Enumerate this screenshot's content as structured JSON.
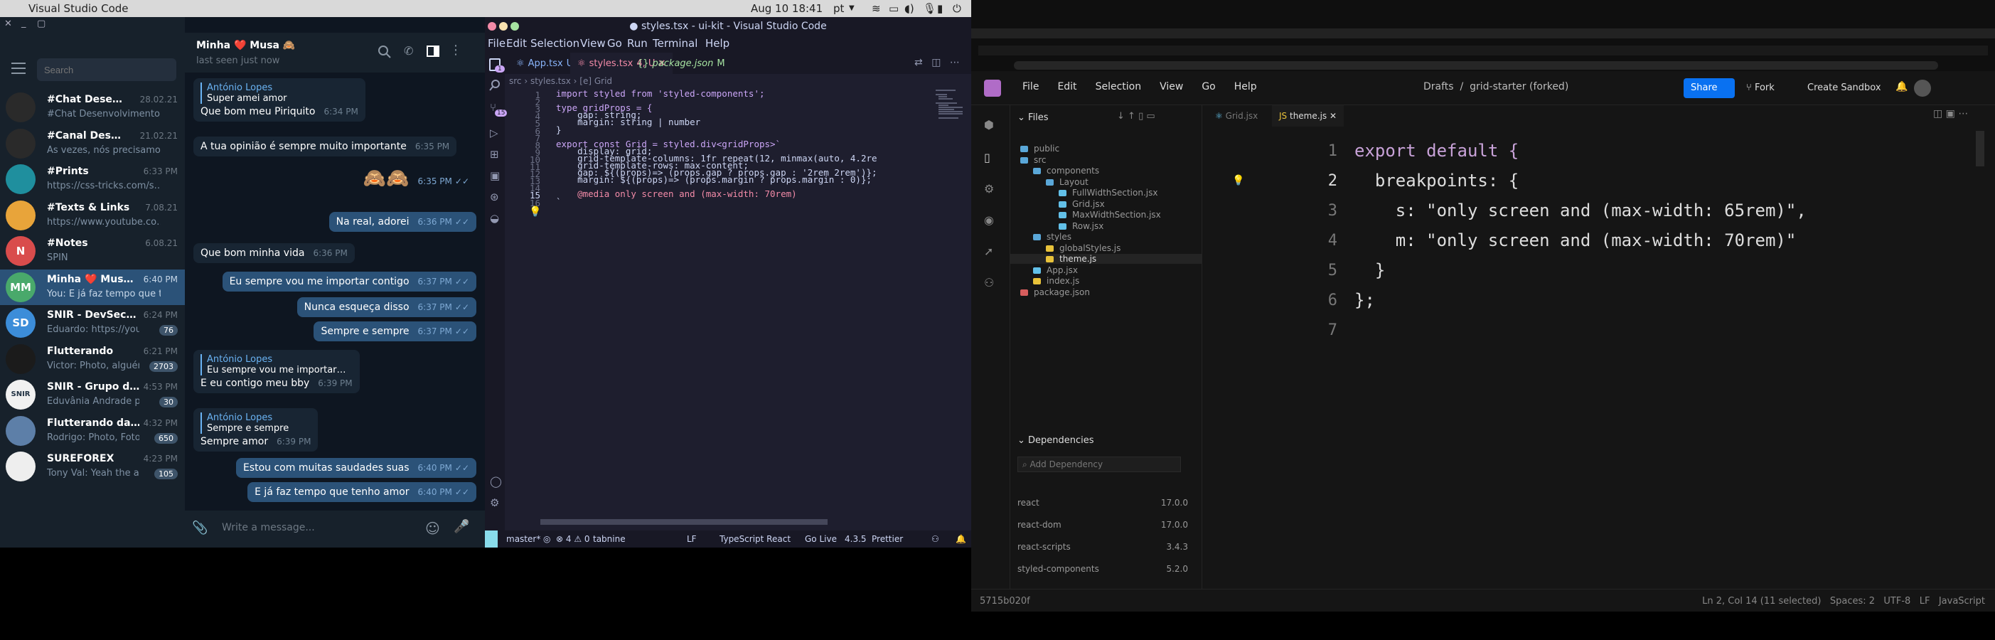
{
  "system": {
    "app_name": "Visual Studio Code",
    "clock": "Aug 10  18:41",
    "language": "pt"
  },
  "telegram": {
    "search_placeholder": "Search",
    "chats": [
      {
        "name": "#Chat Dese…",
        "time": "28.02.21",
        "preview": "#Chat Desenvolvimento…",
        "avatar": "",
        "avatar_color": "#2a2a2a"
      },
      {
        "name": "#Canal Des…",
        "time": "21.02.21",
        "preview": "Às vezes, nós precisamo…",
        "avatar": "",
        "avatar_color": "#2a2a2a"
      },
      {
        "name": "#Prints",
        "time": "6:33 PM",
        "preview": "https://css-tricks.com/s…",
        "avatar": "",
        "avatar_color": "#1f8f9e"
      },
      {
        "name": "#Texts & Links",
        "time": "7.08.21",
        "preview": "https://www.youtube.co…",
        "avatar": "",
        "avatar_color": "#e8a43a"
      },
      {
        "name": "#Notes",
        "time": "6.08.21",
        "preview": "SPIN",
        "avatar": "N",
        "avatar_color": "#d94c4c"
      },
      {
        "name": "Minha ❤️ Mus…",
        "time": "6:40 PM",
        "preview": "You: E já faz tempo que ten…",
        "avatar": "MM",
        "avatar_color": "#49a96b"
      },
      {
        "name": "SNIR - DevSec…",
        "time": "6:24 PM",
        "preview": "Eduardo: https://youtu…",
        "avatar": "SD",
        "avatar_color": "#3c8dd9",
        "badge": "76"
      },
      {
        "name": "Flutterando",
        "time": "6:21 PM",
        "preview": "Victor: Photo, alguém…",
        "avatar": "",
        "avatar_color": "#1b1b1b",
        "badge": "2703"
      },
      {
        "name": "SNIR - Grupo d…",
        "time": "4:53 PM",
        "preview": "Eduvânia Andrade pinn…",
        "avatar": "SNIR",
        "avatar_color": "#f1f1f1",
        "badge": "30"
      },
      {
        "name": "Flutterando da…",
        "time": "4:32 PM",
        "preview": "Rodrigo: Photo, Foto d…",
        "avatar": "",
        "avatar_color": "#5d7fa8",
        "badge": "650"
      },
      {
        "name": "SUREFOREX",
        "time": "4:23 PM",
        "preview": "Tony Val: Yeah the ace…",
        "avatar": "",
        "avatar_color": "#eeeeee",
        "badge": "105"
      }
    ],
    "contact_name": "Minha ❤️ Musa 🙈",
    "contact_status": "last seen just now",
    "messages": [
      {
        "dir": "in",
        "quote_author": "António Lopes",
        "quote_text": "Super amei amor",
        "text": "Que bom meu Piriquito",
        "time": "6:34 PM"
      },
      {
        "dir": "in",
        "text": "A tua opinião é sempre muito importante",
        "time": "6:35 PM"
      },
      {
        "dir": "out",
        "text": "🙈🙈",
        "time": "6:35 PM"
      },
      {
        "dir": "out",
        "text": "Na real, adorei",
        "time": "6:36 PM"
      },
      {
        "dir": "in",
        "text": "Que bom minha vida",
        "time": "6:36 PM"
      },
      {
        "dir": "out",
        "text": "Eu sempre vou me importar contigo",
        "time": "6:37 PM"
      },
      {
        "dir": "out",
        "text": "Nunca esqueça disso",
        "time": "6:37 PM"
      },
      {
        "dir": "out",
        "text": "Sempre e sempre",
        "time": "6:37 PM"
      },
      {
        "dir": "in",
        "quote_author": "António Lopes",
        "quote_text": "Eu sempre vou me importar…",
        "text": "E eu contigo meu bby",
        "time": "6:39 PM"
      },
      {
        "dir": "in",
        "quote_author": "António Lopes",
        "quote_text": "Sempre e sempre",
        "text": "Sempre amor",
        "time": "6:39 PM"
      },
      {
        "dir": "out",
        "text": "Estou com muitas saudades suas",
        "time": "6:40 PM"
      },
      {
        "dir": "out",
        "text": "E já faz tempo que tenho amor",
        "time": "6:40 PM"
      }
    ],
    "composer_placeholder": "Write a message..."
  },
  "vscode": {
    "title": "● styles.tsx - ui-kit - Visual Studio Code",
    "menu": [
      "File",
      "Edit",
      "Selection",
      "View",
      "Go",
      "Run",
      "Terminal",
      "Help"
    ],
    "tabs": [
      {
        "label": "App.tsx",
        "suffix": "U",
        "color": "#89b4fa"
      },
      {
        "label": "styles.tsx",
        "suffix": "4, U",
        "color": "#f38ba8"
      },
      {
        "label": "package.json",
        "suffix": "M",
        "color": "#a6e3a1"
      }
    ],
    "breadcrumb": "src  ›  styles.tsx  ›  [e] Grid",
    "code_lines": [
      "import styled from 'styled-components';",
      "",
      "type gridProps = {",
      "    gap: string;",
      "    margin: string | number",
      "}",
      "",
      "export const Grid = styled.div<gridProps>`",
      "    display: grid;",
      "    grid-template-columns: 1fr repeat(12, minmax(auto, 4.2re",
      "    grid-template-rows: max-content;",
      "    gap: ${(props)=> (props.gap ? props.gap : '2rem 2rem')};",
      "    margin: ${(props)=> (props.margin ? props.margin : 0)};",
      "",
      "    @media only screen and (max-width: 70rem)",
      "`"
    ],
    "status": {
      "branch": "master*",
      "problems": "⊗ 4 ⚠ 0",
      "tabnine": "tabnine",
      "eol": "LF",
      "language": "TypeScript React",
      "golive": "Go Live",
      "version": "4.3.5",
      "prettier": "Prettier"
    },
    "activity_badges": {
      "explorer": "1",
      "scm": "15"
    }
  },
  "codesandbox": {
    "menu": [
      "File",
      "Edit",
      "Selection",
      "View",
      "Go",
      "Help"
    ],
    "breadcrumb": "Drafts  /  grid-starter (forked)",
    "share_label": "Share",
    "fork_label": "Fork",
    "create_label": "Create Sandbox",
    "files_label": "Files",
    "tree": [
      {
        "name": "public",
        "type": "folder",
        "depth": 0
      },
      {
        "name": "src",
        "type": "folder",
        "depth": 0
      },
      {
        "name": "components",
        "type": "folder",
        "depth": 1
      },
      {
        "name": "Layout",
        "type": "folder",
        "depth": 2
      },
      {
        "name": "FullWidthSection.jsx",
        "type": "file",
        "depth": 3
      },
      {
        "name": "Grid.jsx",
        "type": "file",
        "depth": 3
      },
      {
        "name": "MaxWidthSection.jsx",
        "type": "file",
        "depth": 3
      },
      {
        "name": "Row.jsx",
        "type": "file",
        "depth": 3
      },
      {
        "name": "styles",
        "type": "folder",
        "depth": 1
      },
      {
        "name": "globalStyles.js",
        "type": "js",
        "depth": 2
      },
      {
        "name": "theme.js",
        "type": "js",
        "depth": 2
      },
      {
        "name": "App.jsx",
        "type": "file",
        "depth": 1
      },
      {
        "name": "index.js",
        "type": "js",
        "depth": 1
      },
      {
        "name": "package.json",
        "type": "pkg",
        "depth": 0
      }
    ],
    "deps_label": "Dependencies",
    "add_dep_placeholder": "Add Dependency",
    "dependencies": [
      {
        "name": "react",
        "version": "17.0.0"
      },
      {
        "name": "react-dom",
        "version": "17.0.0"
      },
      {
        "name": "react-scripts",
        "version": "3.4.3"
      },
      {
        "name": "styled-components",
        "version": "5.2.0"
      }
    ],
    "editor_tabs": [
      "Grid.jsx",
      "theme.js"
    ],
    "code_lines": [
      "export default {",
      "  breakpoints: {",
      "    s: \"only screen and (max-width: 65rem)\",",
      "    m: \"only screen and (max-width: 70rem)\"",
      "  }",
      "};",
      ""
    ],
    "status_left": "5715b020f",
    "status_right": "Ln 2, Col 14 (11 selected)   Spaces: 2   UTF-8   LF   JavaScript"
  }
}
